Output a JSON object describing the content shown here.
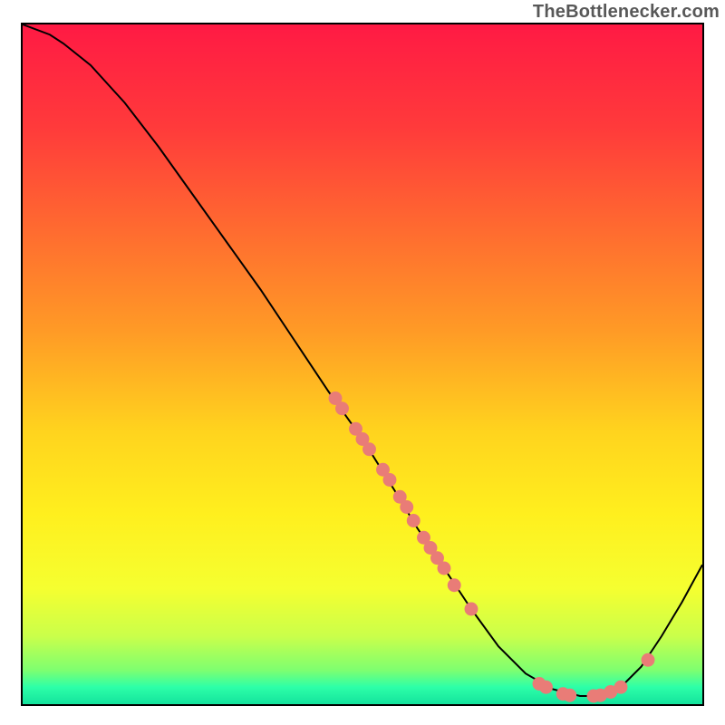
{
  "attribution": "TheBottlenecker.com",
  "colors": {
    "curve_stroke": "#000000",
    "point_fill": "#e97c77",
    "gradient_stops": [
      {
        "offset": 0.0,
        "color": "#ff1a44"
      },
      {
        "offset": 0.15,
        "color": "#ff3a3b"
      },
      {
        "offset": 0.3,
        "color": "#ff6a30"
      },
      {
        "offset": 0.45,
        "color": "#ff9a26"
      },
      {
        "offset": 0.6,
        "color": "#ffd41e"
      },
      {
        "offset": 0.72,
        "color": "#ffef1e"
      },
      {
        "offset": 0.83,
        "color": "#f5ff30"
      },
      {
        "offset": 0.9,
        "color": "#caff4a"
      },
      {
        "offset": 0.95,
        "color": "#7eff70"
      },
      {
        "offset": 0.975,
        "color": "#2dffa8"
      },
      {
        "offset": 1.0,
        "color": "#14e39d"
      }
    ]
  },
  "chart_data": {
    "type": "line",
    "title": "",
    "xlabel": "",
    "ylabel": "",
    "xlim": [
      0,
      100
    ],
    "ylim": [
      0,
      100
    ],
    "series": [
      {
        "name": "curve",
        "x": [
          0,
          4,
          6,
          10,
          15,
          20,
          25,
          30,
          35,
          40,
          45,
          50,
          55,
          58,
          62,
          66,
          70,
          74,
          78,
          82,
          85,
          88,
          91,
          94,
          97,
          100
        ],
        "y": [
          100,
          98.5,
          97.2,
          94,
          88.5,
          82,
          75,
          68,
          61,
          53.5,
          46,
          39,
          31,
          26,
          20,
          14,
          8.5,
          4.5,
          2.2,
          1.2,
          1.2,
          2.5,
          5.5,
          10,
          15,
          20.5
        ]
      }
    ],
    "points": [
      {
        "x": 46,
        "y": 45
      },
      {
        "x": 47,
        "y": 43.5
      },
      {
        "x": 49,
        "y": 40.5
      },
      {
        "x": 50,
        "y": 39
      },
      {
        "x": 51,
        "y": 37.5
      },
      {
        "x": 53,
        "y": 34.5
      },
      {
        "x": 54,
        "y": 33
      },
      {
        "x": 55.5,
        "y": 30.5
      },
      {
        "x": 56.5,
        "y": 29
      },
      {
        "x": 57.5,
        "y": 27
      },
      {
        "x": 59,
        "y": 24.5
      },
      {
        "x": 60,
        "y": 23
      },
      {
        "x": 61,
        "y": 21.5
      },
      {
        "x": 62,
        "y": 20
      },
      {
        "x": 63.5,
        "y": 17.5
      },
      {
        "x": 66,
        "y": 14
      },
      {
        "x": 76,
        "y": 3
      },
      {
        "x": 77,
        "y": 2.5
      },
      {
        "x": 79.5,
        "y": 1.5
      },
      {
        "x": 80.5,
        "y": 1.3
      },
      {
        "x": 84,
        "y": 1.2
      },
      {
        "x": 85,
        "y": 1.3
      },
      {
        "x": 86.5,
        "y": 1.8
      },
      {
        "x": 88,
        "y": 2.5
      },
      {
        "x": 92,
        "y": 6.5
      }
    ],
    "point_radius_px": 7.5
  }
}
